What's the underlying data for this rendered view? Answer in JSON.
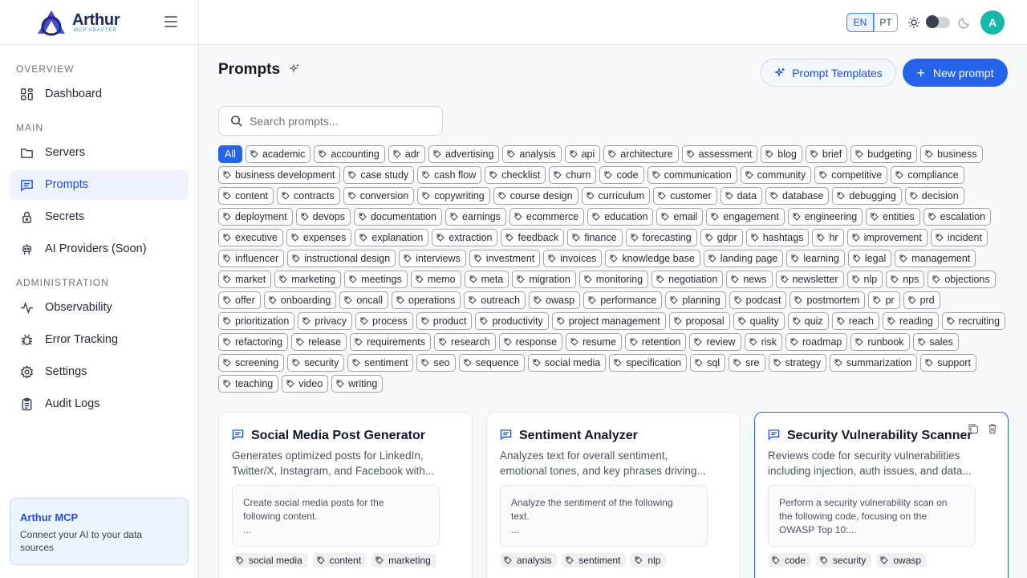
{
  "brand": {
    "name": "Arthur",
    "subtitle": "MCP ADAPTER"
  },
  "sidebar": {
    "sections": {
      "overview": "OVERVIEW",
      "main": "MAIN",
      "administration": "ADMINISTRATION"
    },
    "items": [
      {
        "label": "Dashboard",
        "icon": "dashboard-icon"
      },
      {
        "label": "Servers",
        "icon": "folder-icon"
      },
      {
        "label": "Prompts",
        "icon": "message-icon",
        "active": true
      },
      {
        "label": "Secrets",
        "icon": "lock-icon"
      },
      {
        "label": "AI Providers (Soon)",
        "icon": "robot-icon"
      },
      {
        "label": "Observability",
        "icon": "activity-icon"
      },
      {
        "label": "Error Tracking",
        "icon": "bug-icon"
      },
      {
        "label": "Settings",
        "icon": "gear-icon"
      },
      {
        "label": "Audit Logs",
        "icon": "clipboard-icon"
      }
    ],
    "promo": {
      "title": "Arthur MCP",
      "text": "Connect your AI to your data sources"
    }
  },
  "topbar": {
    "lang_en": "EN",
    "lang_pt": "PT",
    "avatar_initial": "A"
  },
  "main": {
    "title": "Prompts",
    "templates_label": "Prompt Templates",
    "new_label": "New prompt",
    "search_placeholder": "Search prompts..."
  },
  "tags": [
    "All",
    "academic",
    "accounting",
    "adr",
    "advertising",
    "analysis",
    "api",
    "architecture",
    "assessment",
    "blog",
    "brief",
    "budgeting",
    "business",
    "business development",
    "case study",
    "cash flow",
    "checklist",
    "churn",
    "code",
    "communication",
    "community",
    "competitive",
    "compliance",
    "content",
    "contracts",
    "conversion",
    "copywriting",
    "course design",
    "curriculum",
    "customer",
    "data",
    "database",
    "debugging",
    "decision",
    "deployment",
    "devops",
    "documentation",
    "earnings",
    "ecommerce",
    "education",
    "email",
    "engagement",
    "engineering",
    "entities",
    "escalation",
    "executive",
    "expenses",
    "explanation",
    "extraction",
    "feedback",
    "finance",
    "forecasting",
    "gdpr",
    "hashtags",
    "hr",
    "improvement",
    "incident",
    "influencer",
    "instructional design",
    "interviews",
    "investment",
    "invoices",
    "knowledge base",
    "landing page",
    "learning",
    "legal",
    "management",
    "market",
    "marketing",
    "meetings",
    "memo",
    "meta",
    "migration",
    "monitoring",
    "negotiation",
    "news",
    "newsletter",
    "nlp",
    "nps",
    "objections",
    "offer",
    "onboarding",
    "oncall",
    "operations",
    "outreach",
    "owasp",
    "performance",
    "planning",
    "podcast",
    "postmortem",
    "pr",
    "prd",
    "prioritization",
    "privacy",
    "process",
    "product",
    "productivity",
    "project management",
    "proposal",
    "quality",
    "quiz",
    "reach",
    "reading",
    "recruiting",
    "refactoring",
    "release",
    "requirements",
    "research",
    "response",
    "resume",
    "retention",
    "review",
    "risk",
    "roadmap",
    "runbook",
    "sales",
    "screening",
    "security",
    "sentiment",
    "seo",
    "sequence",
    "social media",
    "specification",
    "sql",
    "sre",
    "strategy",
    "summarization",
    "support",
    "teaching",
    "video",
    "writing"
  ],
  "cards": [
    {
      "title": "Social Media Post Generator",
      "description": "Generates optimized posts for LinkedIn, Twitter/X, Instagram, and Facebook with...",
      "preview_line1": "Create social media posts for the",
      "preview_line2": "following content.",
      "preview_line3": "...",
      "tags": [
        "social media",
        "content",
        "marketing"
      ]
    },
    {
      "title": "Sentiment Analyzer",
      "description": "Analyzes text for overall sentiment, emotional tones, and key phrases driving...",
      "preview_line1": "Analyze the sentiment of the following",
      "preview_line2": "text.",
      "preview_line3": "...",
      "tags": [
        "analysis",
        "sentiment",
        "nlp"
      ]
    },
    {
      "title": "Security Vulnerability Scanner",
      "description": "Reviews code for security vulnerabilities including injection, auth issues, and data...",
      "preview_line1": "Perform a security vulnerability scan on",
      "preview_line2": "the following code, focusing on the",
      "preview_line3": "OWASP Top 10:...",
      "tags": [
        "code",
        "security",
        "owasp"
      ],
      "selected": true
    }
  ],
  "colors": {
    "accent": "#2563eb",
    "avatar": "#14b8a6",
    "brand_dark": "#1e2a5a"
  }
}
